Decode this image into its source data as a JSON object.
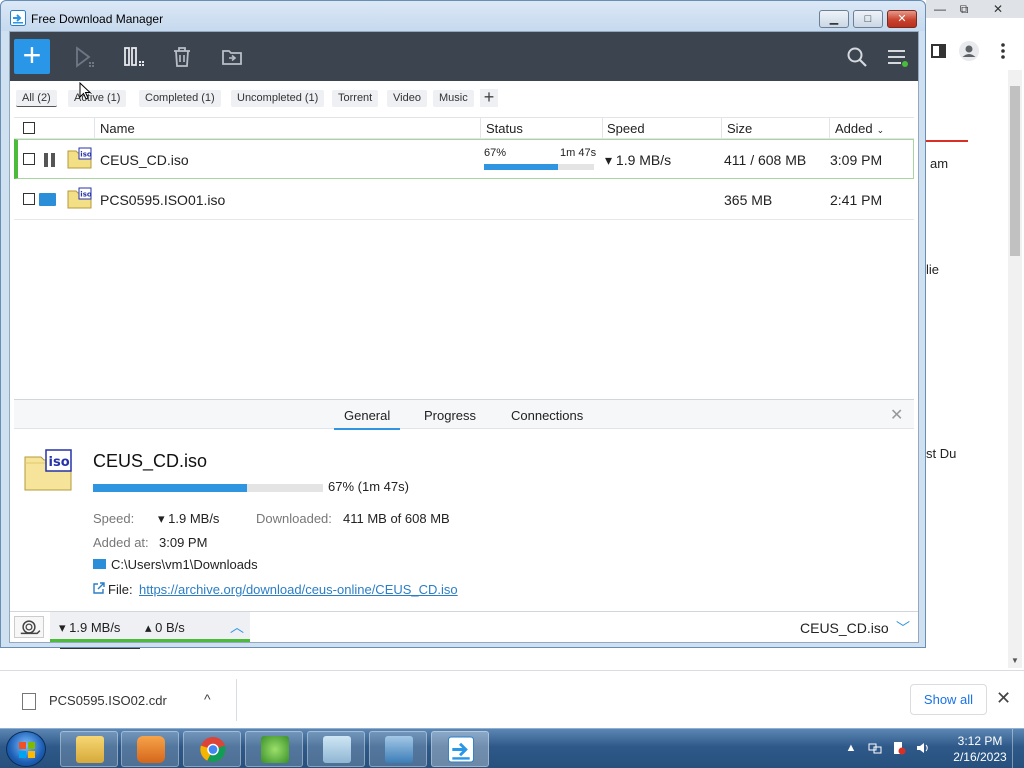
{
  "window": {
    "title": "Free Download Manager",
    "minimize_glyph": "▁",
    "maximize_glyph": "□",
    "close_glyph": "✕"
  },
  "toolbar": {
    "add_label": "+",
    "icons": [
      "add-icon",
      "start-icon",
      "pause-all-icon",
      "delete-icon",
      "move-icon",
      "search-icon",
      "menu-icon"
    ]
  },
  "filters": {
    "all": "All (2)",
    "active": "Active (1)",
    "completed": "Completed (1)",
    "uncompleted": "Uncompleted (1)",
    "torrent": "Torrent",
    "video": "Video",
    "music": "Music",
    "add": "+"
  },
  "columns": {
    "name": "Name",
    "status": "Status",
    "speed": "Speed",
    "size": "Size",
    "added": "Added",
    "sort_glyph": "⌄"
  },
  "downloads": [
    {
      "name": "CEUS_CD.iso",
      "status_pct": "67%",
      "status_eta": "1m 47s",
      "progress": 0.67,
      "speed": "▾ 1.9 MB/s",
      "size": "411 / 608 MB",
      "added": "3:09 PM",
      "state": "downloading"
    },
    {
      "name": "PCS0595.ISO01.iso",
      "status_pct": "",
      "status_eta": "",
      "progress": 1,
      "speed": "",
      "size": "365 MB",
      "added": "2:41 PM",
      "state": "completed"
    }
  ],
  "details": {
    "tabs": [
      "General",
      "Progress",
      "Connections"
    ],
    "close_glyph": "✕",
    "name": "CEUS_CD.iso",
    "progress": 0.67,
    "progress_text": "67% (1m 47s)",
    "speed_label": "Speed:",
    "speed_value": "▾ 1.9 MB/s",
    "downloaded_label": "Downloaded:",
    "downloaded_value": "411 MB of 608 MB",
    "added_label": "Added at:",
    "added_value": "3:09 PM",
    "path": "C:\\Users\\vm1\\Downloads",
    "file_label": "File:",
    "url": "https://archive.org/download/ceus-online/CEUS_CD.iso"
  },
  "statusbar": {
    "down": "▾ 1.9 MB/s",
    "up": "▴ 0 B/s",
    "expand_glyph": "︿",
    "current_file": "CEUS_CD.iso",
    "chevron_glyph": "﹀"
  },
  "browser": {
    "caption_min": "—",
    "caption_max": "⧉",
    "caption_close": "✕",
    "side_snippets": [
      "am",
      "lie",
      "st Du"
    ]
  },
  "download_bar": {
    "file_name": "PCS0595.ISO02.cdr",
    "chevron": "^",
    "show_all": "Show all",
    "close": "✕"
  },
  "taskbar": {
    "time": "3:12 PM",
    "date": "2/16/2023",
    "tray_arrow": "▲"
  },
  "colors": {
    "accent": "#2a96e8",
    "toolbar_bg": "#3c4450",
    "progress": "#2f95e0",
    "active_green": "#4cbb3c",
    "link": "#2a7ec6"
  }
}
